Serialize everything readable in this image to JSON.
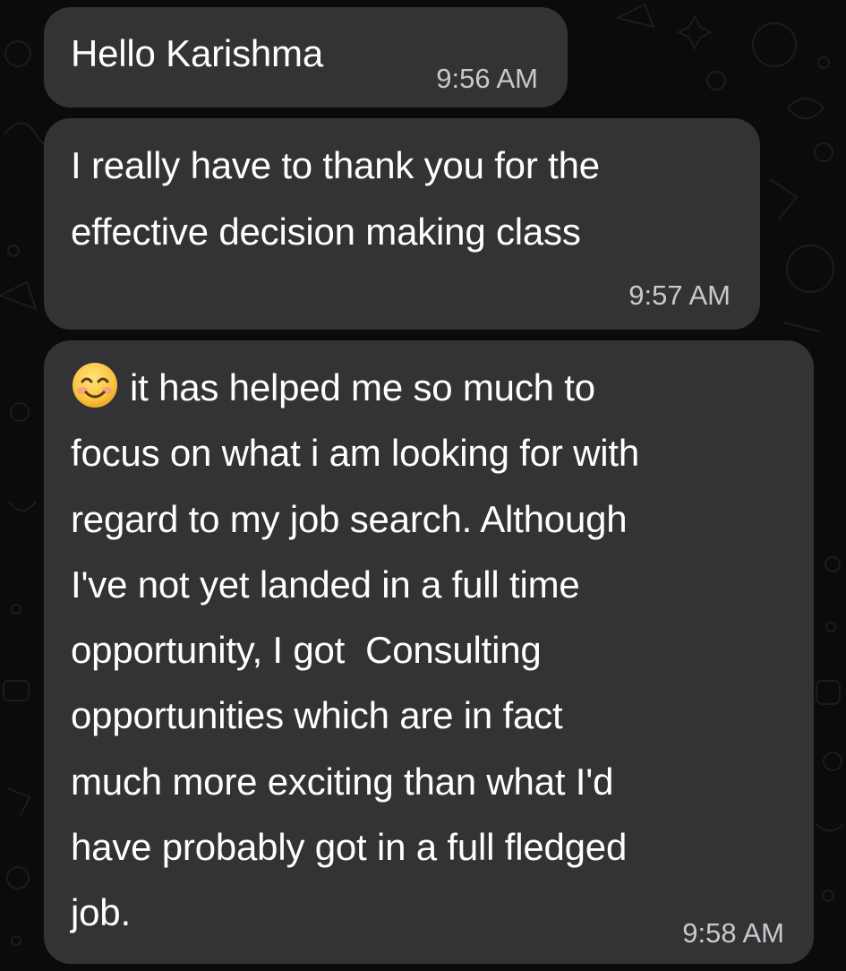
{
  "chat": {
    "messages": [
      {
        "text": "Hello Karishma",
        "time": "9:56 AM"
      },
      {
        "text": "I really have to thank you for the\neffective decision making class",
        "time": "9:57 AM"
      },
      {
        "emoji": "smiling-face-with-smiling-eyes-icon",
        "text": "it has helped me so much to\nfocus on what i am looking for with\nregard to my job search. Although\nI've not yet landed in a full time\nopportunity, I got  Consulting\nopportunities which are in fact\nmuch more exciting than what I'd\nhave probably got in a full fledged\njob.",
        "time": "9:58 AM"
      }
    ]
  },
  "colors": {
    "background": "#0b0b0b",
    "bubble": "#333336",
    "text": "#ffffff",
    "timestamp": "#c9c9cc"
  }
}
